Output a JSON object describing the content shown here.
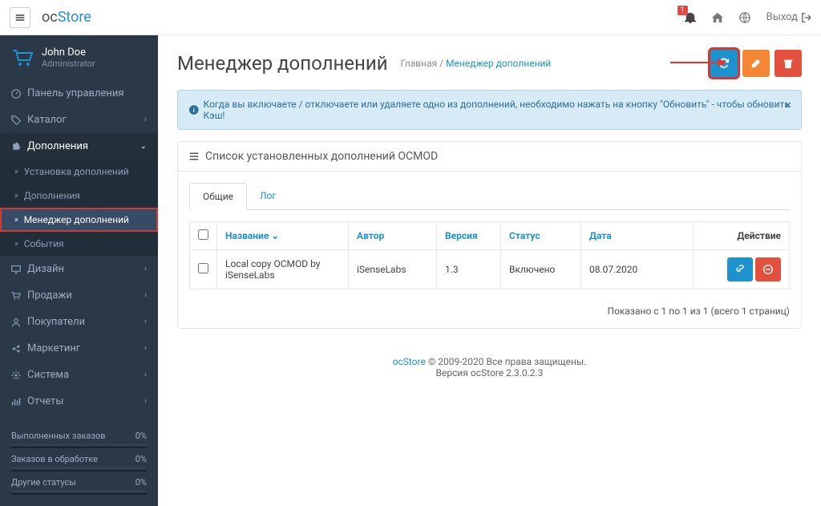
{
  "logo": {
    "part1": "oc",
    "part2": "Store"
  },
  "header": {
    "badge": "1",
    "logout": "Выход"
  },
  "user": {
    "name": "John Doe",
    "role": "Administrator"
  },
  "menu": {
    "dashboard": "Панель управления",
    "catalog": "Каталог",
    "extensions": "Дополнения",
    "design": "Дизайн",
    "sales": "Продажи",
    "customers": "Покупатели",
    "marketing": "Маркетинг",
    "system": "Система",
    "reports": "Отчеты"
  },
  "submenu": {
    "installer": "Установка дополнений",
    "extensions": "Дополнения",
    "modifications": "Менеджер дополнений",
    "events": "События"
  },
  "stats": {
    "completed": "Выполненных заказов",
    "processing": "Заказов в обработке",
    "other": "Другие статусы",
    "pct": "0%"
  },
  "page": {
    "title": "Менеджер дополнений",
    "crumb1": "Главная",
    "crumb2": "Менеджер дополнений"
  },
  "alert": "Когда вы включаете / отключаете или удаляете одно из дополнений, необходимо нажать на кнопку \"Обновить\" - чтобы обновить Кэш!",
  "panel": {
    "title": "Список установленных дополнений OCMOD"
  },
  "tabs": {
    "general": "Общие",
    "log": "Лог"
  },
  "table": {
    "cols": {
      "name": "Название",
      "author": "Автор",
      "version": "Версия",
      "status": "Статус",
      "date": "Дата",
      "action": "Действие"
    },
    "rows": [
      {
        "name": "Local copy OCMOD by iSenseLabs",
        "author": "iSenseLabs",
        "version": "1.3",
        "status": "Включено",
        "date": "08.07.2020"
      }
    ]
  },
  "pager": "Показано с 1 по 1 из 1 (всего 1 страниц)",
  "footer": {
    "brand": "ocStore",
    "copy": " © 2009-2020 Все права защищены.",
    "ver": "Версия ocStore 2.3.0.2.3"
  }
}
